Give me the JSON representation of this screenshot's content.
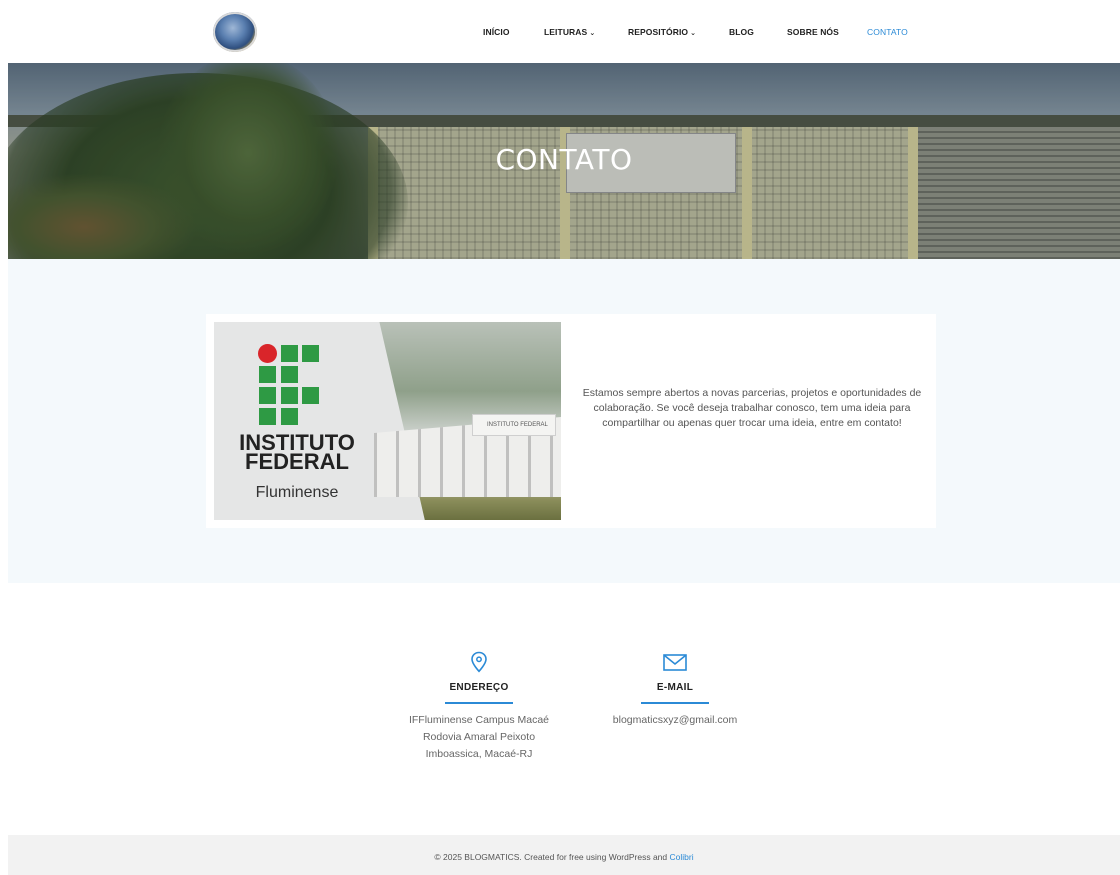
{
  "header": {
    "nav": [
      {
        "label": "INÍCIO",
        "dropdown": false,
        "active": false
      },
      {
        "label": "LEITURAS",
        "dropdown": true,
        "active": false
      },
      {
        "label": "REPOSITÓRIO",
        "dropdown": true,
        "active": false
      },
      {
        "label": "BLOG",
        "dropdown": false,
        "active": false
      },
      {
        "label": "SOBRE NÓS",
        "dropdown": false,
        "active": false
      },
      {
        "label": "CONTATO",
        "dropdown": false,
        "active": true
      }
    ],
    "chevron": "⌄"
  },
  "hero": {
    "title": "CONTATO"
  },
  "intro": {
    "image_text": {
      "line1": "INSTITUTO",
      "line2": "FEDERAL",
      "line3": "Fluminense",
      "wall_sign": "INSTITUTO FEDERAL"
    },
    "text": "Estamos sempre abertos a novas parcerias, projetos e oportunidades de colaboração. Se você deseja trabalhar conosco, tem uma ideia para compartilhar ou apenas quer trocar uma ideia, entre em contato!"
  },
  "contact": {
    "address": {
      "icon": "location-pin-icon",
      "title": "ENDEREÇO",
      "lines": [
        "IFFluminense Campus Macaé",
        "Rodovia Amaral Peixoto",
        "Imboassica, Macaé-RJ"
      ]
    },
    "email": {
      "icon": "mail-icon",
      "title": "E-MAIL",
      "value": "blogmaticsxyz@gmail.com"
    }
  },
  "footer": {
    "text": "© 2025 BLOGMATICS. Created for free using WordPress and",
    "link": "Colibri"
  },
  "colors": {
    "accent": "#2b8ad6",
    "section_bg": "#f4f9fc",
    "footer_bg": "#f2f2f2"
  }
}
